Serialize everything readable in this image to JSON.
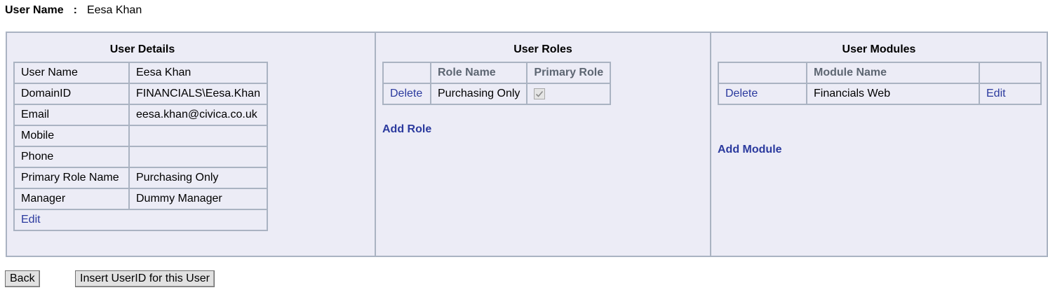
{
  "header": {
    "label": "User Name",
    "colon": ":",
    "value": "Eesa Khan"
  },
  "user_details": {
    "title": "User Details",
    "rows": [
      {
        "key": "User Name",
        "value": "Eesa Khan"
      },
      {
        "key": "DomainID",
        "value": "FINANCIALS\\Eesa.Khan"
      },
      {
        "key": "Email",
        "value": "eesa.khan@civica.co.uk"
      },
      {
        "key": "Mobile",
        "value": ""
      },
      {
        "key": "Phone",
        "value": ""
      },
      {
        "key": "Primary Role Name",
        "value": "Purchasing Only"
      },
      {
        "key": "Manager",
        "value": "Dummy Manager"
      }
    ],
    "edit_label": "Edit"
  },
  "user_roles": {
    "title": "User Roles",
    "columns": [
      "",
      "Role Name",
      "Primary Role"
    ],
    "rows": [
      {
        "action": "Delete",
        "role_name": "Purchasing Only",
        "primary": true
      }
    ],
    "add_label": "Add Role"
  },
  "user_modules": {
    "title": "User Modules",
    "columns": [
      "",
      "Module Name",
      ""
    ],
    "rows": [
      {
        "action": "Delete",
        "module_name": "Financials Web",
        "edit": "Edit"
      }
    ],
    "add_label": "Add Module"
  },
  "buttons": {
    "back": "Back",
    "insert_userid": "Insert UserID for this User"
  },
  "colors": {
    "panel_bg": "#ececf6",
    "border": "#aab3c2",
    "link": "#2b3a9e",
    "header_text": "#5d6672"
  }
}
